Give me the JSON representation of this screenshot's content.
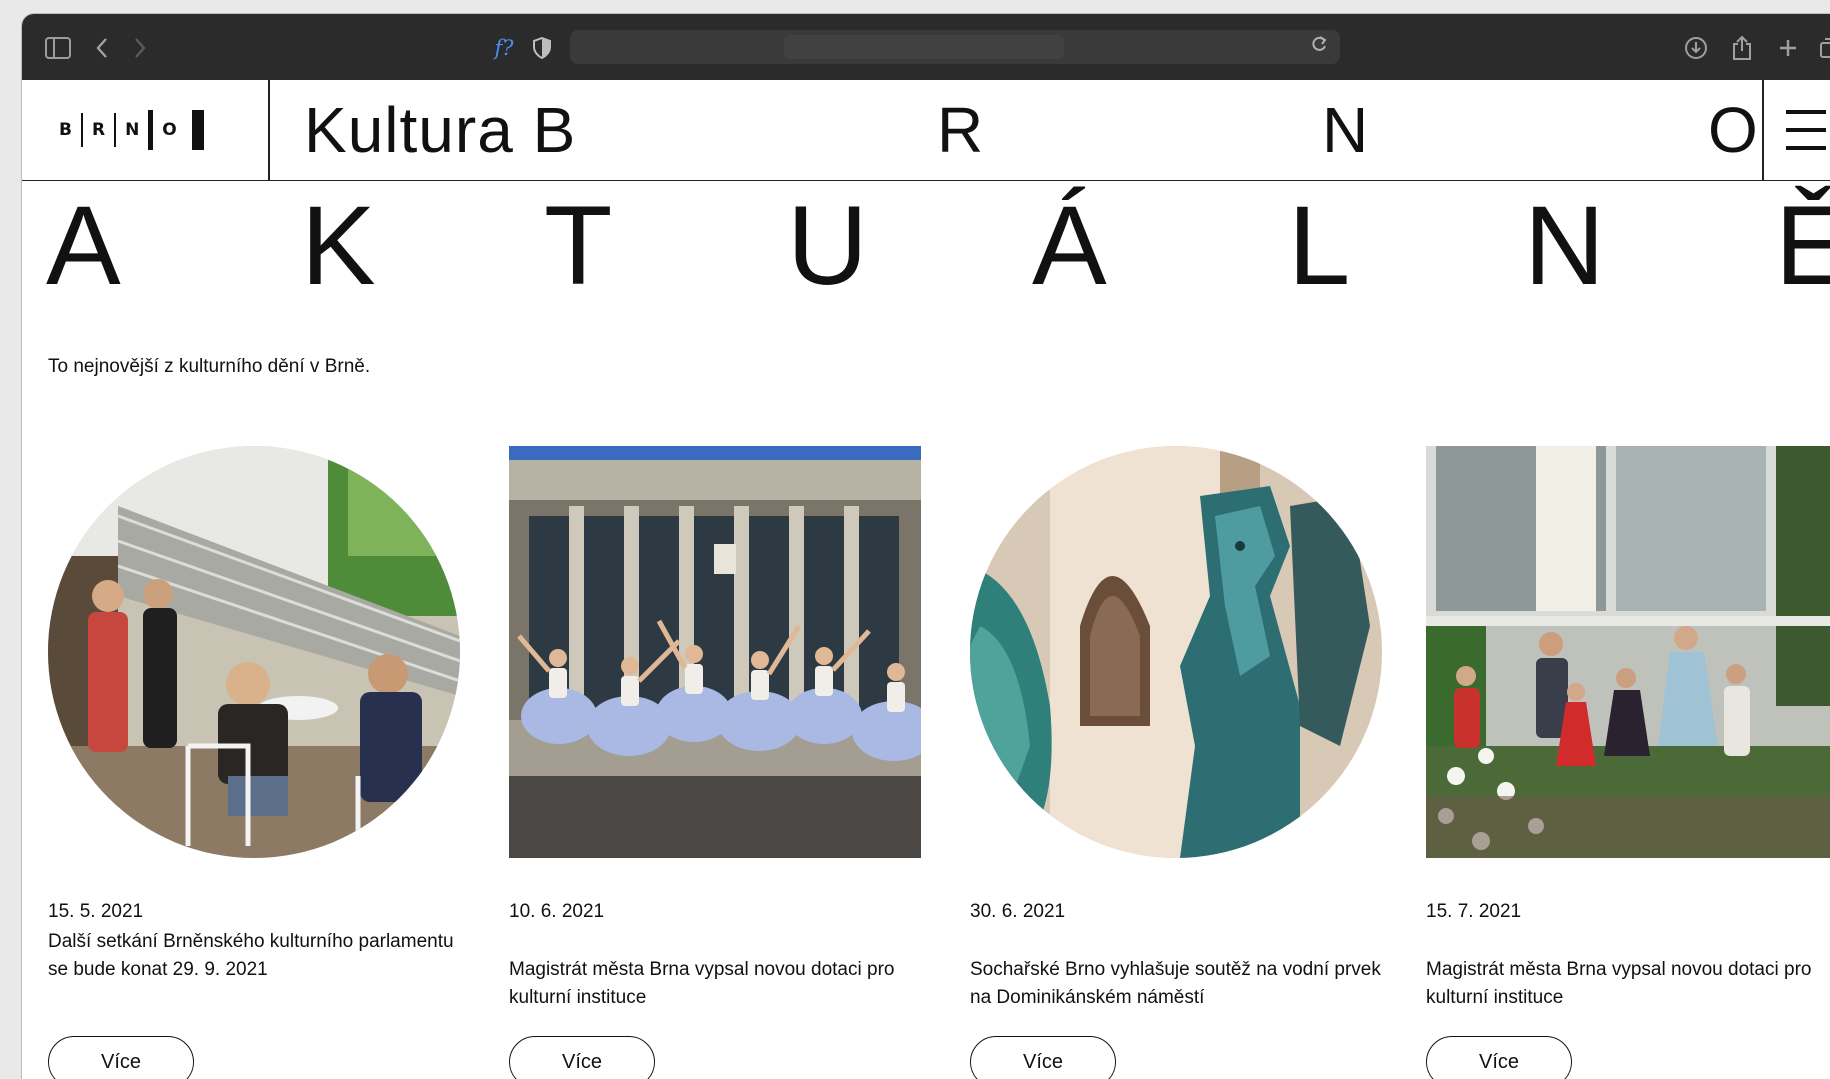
{
  "site": {
    "logo_letters": [
      "B",
      "R",
      "N",
      "O"
    ],
    "brand_words": [
      "Kultura B",
      "R",
      "N",
      "O"
    ],
    "headline_letters": [
      "A",
      "K",
      "T",
      "U",
      "Á",
      "L",
      "N",
      "Ě"
    ],
    "subtitle": "To nejnovější z kulturního dění v Brně."
  },
  "toolbar": {
    "reader_glyph": "f?"
  },
  "cards": [
    {
      "date": "15. 5. 2021",
      "title": "Další setkání Brněnského kulturního parlamentu se bude konat 29. 9. 2021",
      "button": "Více",
      "shape": "circle"
    },
    {
      "date": "10. 6. 2021",
      "title": "Magistrát města Brna vypsal novou dotaci pro kulturní instituce",
      "button": "Více",
      "shape": "square"
    },
    {
      "date": "30. 6. 2021",
      "title": "Sochařské Brno vyhlašuje soutěž na vodní prvek na Dominikánském náměstí",
      "button": "Více",
      "shape": "circle"
    },
    {
      "date": "15. 7. 2021",
      "title": "Magistrát města Brna vypsal novou dotaci pro kulturní instituce",
      "button": "Více",
      "shape": "square"
    }
  ],
  "colors": {
    "toolbar_bg": "#2b2b2b",
    "page_bg": "#ffffff",
    "text": "#111111"
  }
}
